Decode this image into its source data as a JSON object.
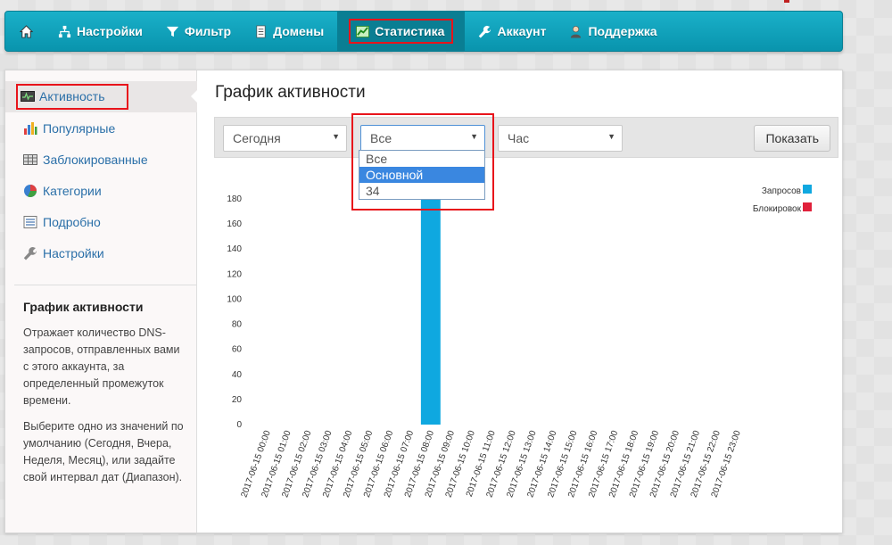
{
  "nav": {
    "items": [
      {
        "name": "home",
        "label": "",
        "icon": "home-icon"
      },
      {
        "name": "settings",
        "label": "Настройки",
        "icon": "sitemap-icon"
      },
      {
        "name": "filter",
        "label": "Фильтр",
        "icon": "filter-icon"
      },
      {
        "name": "domains",
        "label": "Домены",
        "icon": "document-icon"
      },
      {
        "name": "statistics",
        "label": "Статистика",
        "icon": "chart-icon",
        "active": true
      },
      {
        "name": "account",
        "label": "Аккаунт",
        "icon": "wrench-icon"
      },
      {
        "name": "support",
        "label": "Поддержка",
        "icon": "user-icon"
      }
    ]
  },
  "sidebar": {
    "items": [
      {
        "label": "Активность",
        "icon": "activity-icon",
        "active": true
      },
      {
        "label": "Популярные",
        "icon": "bar-chart-icon"
      },
      {
        "label": "Заблокированные",
        "icon": "blocked-grid-icon"
      },
      {
        "label": "Категории",
        "icon": "pie-chart-icon"
      },
      {
        "label": "Подробно",
        "icon": "list-icon"
      },
      {
        "label": "Настройки",
        "icon": "wrench-icon"
      }
    ],
    "help_title": "График активности",
    "help_p1": "Отражает количество DNS-запросов, отправленных вами с этого аккаунта, за определенный промежуток времени.",
    "help_p2": "Выберите одно из значений по умолчанию (Сегодня, Вчера, Неделя, Месяц), или задайте свой интервал дат (Диапазон)."
  },
  "main": {
    "title": "График активности",
    "filters": {
      "period": "Сегодня",
      "profile": "Все",
      "granularity": "Час",
      "show_button": "Показать",
      "profile_options": [
        "Все",
        "Основной",
        "34"
      ],
      "profile_highlighted": "Основной"
    }
  },
  "chart_data": {
    "type": "bar",
    "categories": [
      "2017-06-15 00:00",
      "2017-06-15 01:00",
      "2017-06-15 02:00",
      "2017-06-15 03:00",
      "2017-06-15 04:00",
      "2017-06-15 05:00",
      "2017-06-15 06:00",
      "2017-06-15 07:00",
      "2017-06-15 08:00",
      "2017-06-15 09:00",
      "2017-06-15 10:00",
      "2017-06-15 11:00",
      "2017-06-15 12:00",
      "2017-06-15 13:00",
      "2017-06-15 14:00",
      "2017-06-15 15:00",
      "2017-06-15 16:00",
      "2017-06-15 17:00",
      "2017-06-15 18:00",
      "2017-06-15 19:00",
      "2017-06-15 20:00",
      "2017-06-15 21:00",
      "2017-06-15 22:00",
      "2017-06-15 23:00"
    ],
    "series": [
      {
        "name": "Запросов",
        "color": "#0fa8e0",
        "values": [
          0,
          0,
          0,
          0,
          0,
          0,
          0,
          0,
          190,
          0,
          0,
          0,
          0,
          0,
          0,
          0,
          0,
          0,
          0,
          0,
          0,
          0,
          0,
          0
        ]
      },
      {
        "name": "Блокировок",
        "color": "#e0213b",
        "values": [
          0,
          0,
          0,
          0,
          0,
          0,
          0,
          0,
          0,
          0,
          0,
          0,
          0,
          0,
          0,
          0,
          0,
          0,
          0,
          0,
          0,
          0,
          0,
          0
        ]
      }
    ],
    "yticks": [
      0,
      20,
      40,
      60,
      80,
      100,
      120,
      140,
      160,
      180
    ],
    "ylim": [
      0,
      180
    ],
    "legend": "top-right"
  }
}
